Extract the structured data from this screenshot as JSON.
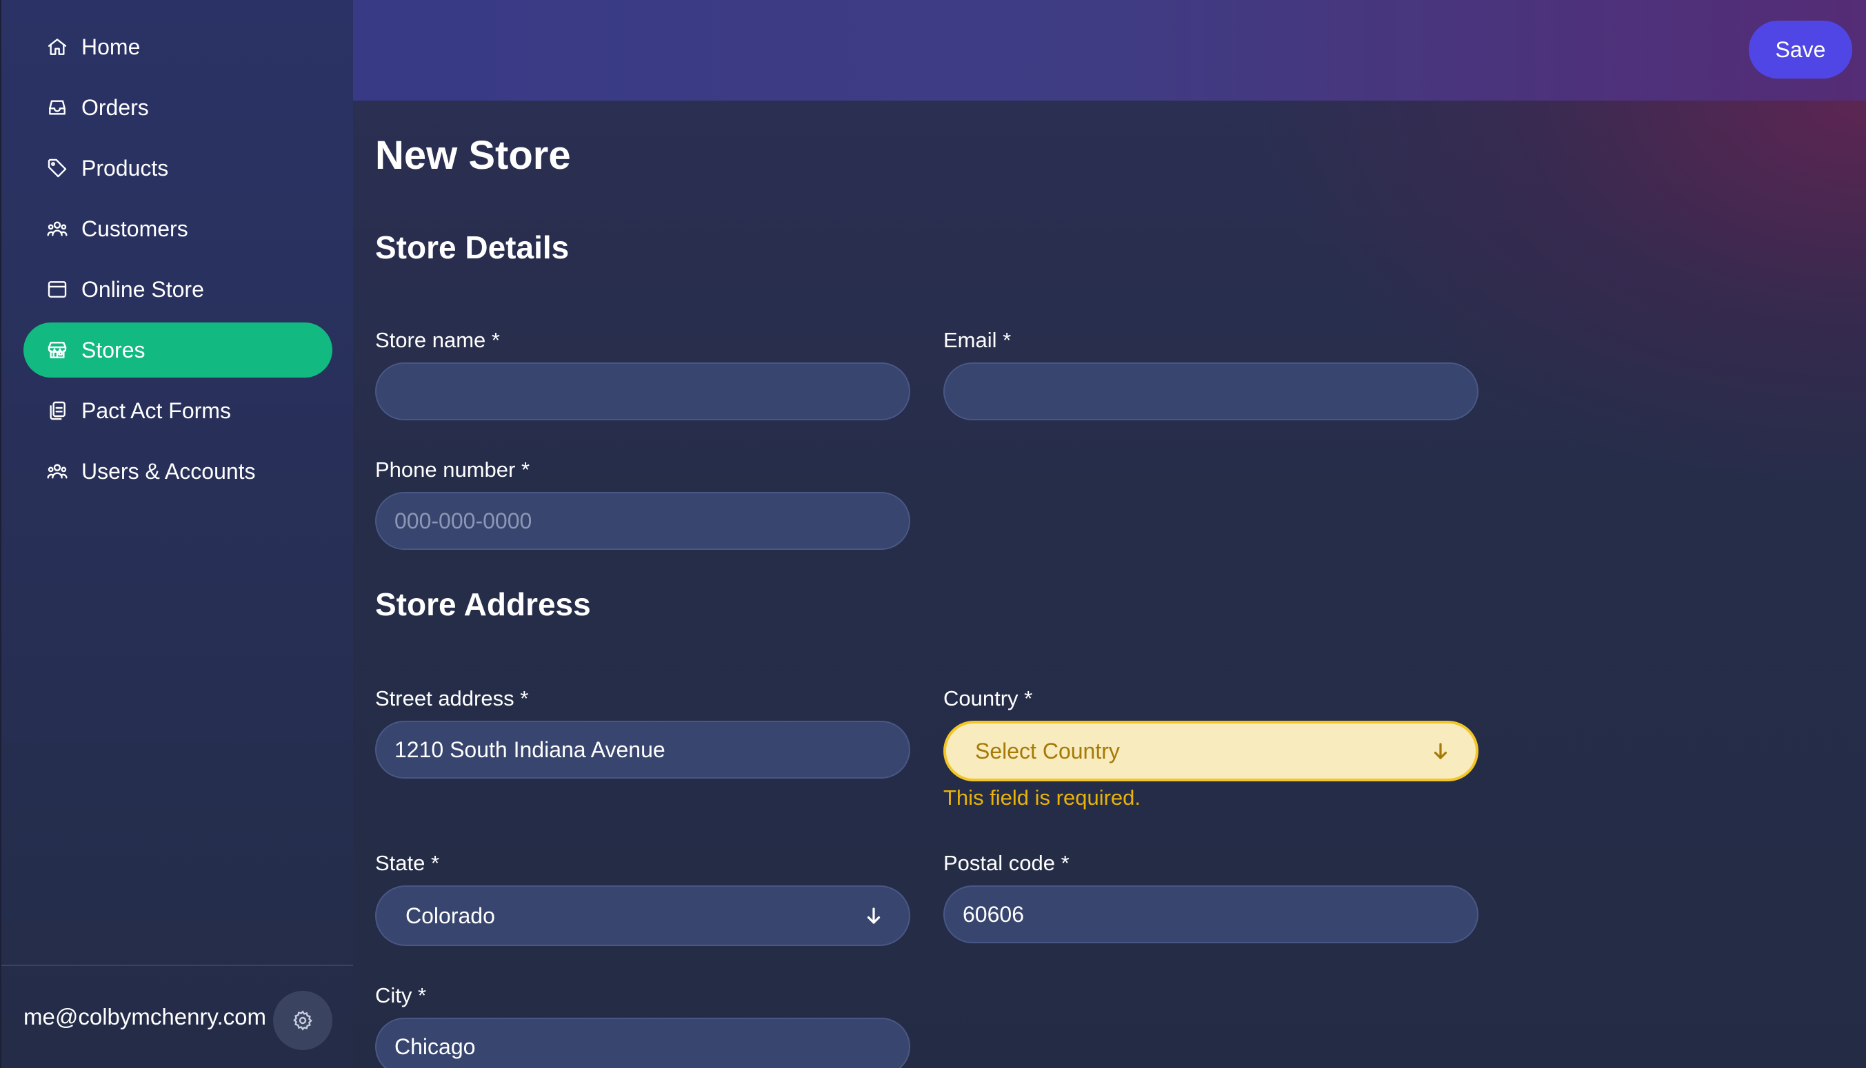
{
  "sidebar": {
    "items": [
      {
        "label": "Home",
        "icon": "home-icon",
        "active": false
      },
      {
        "label": "Orders",
        "icon": "inbox-icon",
        "active": false
      },
      {
        "label": "Products",
        "icon": "tag-icon",
        "active": false
      },
      {
        "label": "Customers",
        "icon": "users-icon",
        "active": false
      },
      {
        "label": "Online Store",
        "icon": "browser-window-icon",
        "active": false
      },
      {
        "label": "Stores",
        "icon": "storefront-icon",
        "active": true
      },
      {
        "label": "Pact Act Forms",
        "icon": "clipboard-copy-icon",
        "active": false
      },
      {
        "label": "Users & Accounts",
        "icon": "user-group-icon",
        "active": false
      }
    ],
    "footer": {
      "email": "me@colbymchenry.com",
      "settings_icon": "gear-icon"
    }
  },
  "topbar": {
    "save_label": "Save"
  },
  "page": {
    "title": "New Store"
  },
  "store_details": {
    "title": "Store Details",
    "store_name": {
      "label": "Store name *",
      "value": "",
      "placeholder": ""
    },
    "email": {
      "label": "Email *",
      "value": "",
      "placeholder": ""
    },
    "phone": {
      "label": "Phone number *",
      "value": "",
      "placeholder": "000-000-0000"
    }
  },
  "store_address": {
    "title": "Store Address",
    "street": {
      "label": "Street address *",
      "value": "1210 South Indiana Avenue"
    },
    "country": {
      "label": "Country *",
      "value": "Select Country",
      "error": "This field is required."
    },
    "state": {
      "label": "State *",
      "value": "Colorado"
    },
    "postal": {
      "label": "Postal code *",
      "value": "60606"
    },
    "city": {
      "label": "City *",
      "value": "Chicago"
    }
  },
  "colors": {
    "active_nav": "#12b981",
    "primary_button": "#4f46e5",
    "input_bg": "#38456e",
    "error_text": "#eab308",
    "error_bg": "#f8ebbd"
  }
}
